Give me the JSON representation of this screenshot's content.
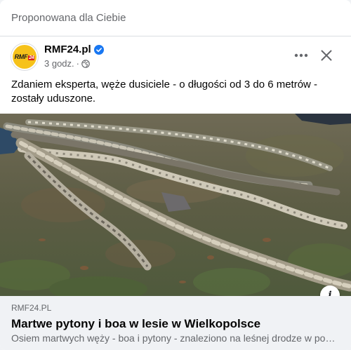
{
  "header": {
    "suggested_label": "Proponowana dla Ciebie"
  },
  "post": {
    "page_name": "RMF24.pl",
    "avatar_logo_text": "RMF",
    "avatar_logo_badge": "24",
    "verified": true,
    "time": "3 godz.",
    "dot": "·",
    "privacy_icon": "globe-icon",
    "text": "Zdaniem eksperta, węże dusiciele - o długości od 3 do 6 metrów - zostały uduszone."
  },
  "actions": {
    "more_icon": "more-icon",
    "close_icon": "close-icon",
    "info_label": "i"
  },
  "link_preview": {
    "domain": "RMF24.PL",
    "title": "Martwe pytony i boa w lesie w Wielkopolsce",
    "description": "Osiem martwych węży - boa i pytony - znaleziono na leśnej drodze w powiecie"
  },
  "colors": {
    "accent_blue": "#1877f2",
    "avatar_yellow": "#f6c21a",
    "link_box_bg": "#f0f2f5",
    "secondary_text": "#65676b"
  }
}
